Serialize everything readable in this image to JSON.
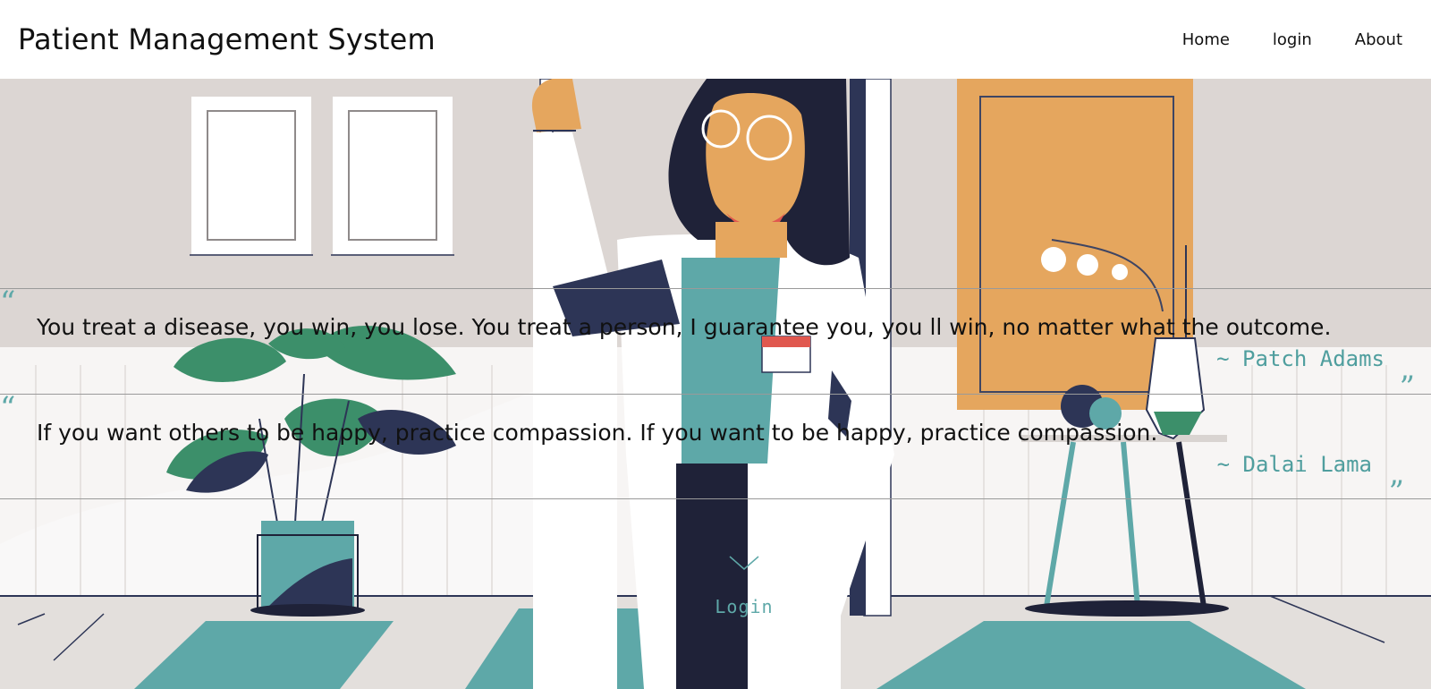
{
  "header": {
    "title": "Patient Management System",
    "nav": [
      {
        "label": "Home"
      },
      {
        "label": "login"
      },
      {
        "label": "About"
      }
    ]
  },
  "quotes": [
    {
      "open_mark": "“",
      "text": "You treat a disease, you win, you lose. You treat a person, I guarantee you, you ll win, no matter what the outcome.",
      "author": "~ Patch Adams",
      "close_mark": "”"
    },
    {
      "open_mark": "“",
      "text": "If you want others to be happy, practice compassion. If you want to be happy, practice compassion.",
      "author": "~ Dalai Lama",
      "close_mark": "”"
    }
  ],
  "cta": {
    "label": "Login",
    "icon": "chevron-down-icon"
  },
  "colors": {
    "accent": "#5ea8a8",
    "orange": "#e5a65e",
    "navy": "#1f2238",
    "wall": "#dcd6d3"
  }
}
